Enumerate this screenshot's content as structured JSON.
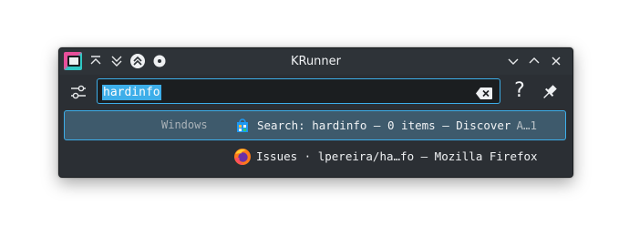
{
  "window": {
    "title": "KRunner",
    "app_icon": "krunner-app-icon",
    "titlebar_buttons_left": [
      "keep-above-icon",
      "keep-below-icon",
      "shade-icon",
      "on-all-desktops-icon"
    ],
    "titlebar_buttons_right": [
      "minimize-icon",
      "maximize-icon",
      "close-icon"
    ]
  },
  "search": {
    "query": "hardinfo",
    "config_icon": "configure-icon",
    "clear_icon": "clear-text-icon",
    "help_label": "?",
    "pin_icon": "pin-icon"
  },
  "results": [
    {
      "category": "Windows",
      "icon": "discover-icon",
      "text": "Search: hardinfo – 0 items — Discover",
      "subtext": "A…1",
      "selected": true
    },
    {
      "category": "",
      "icon": "firefox-icon",
      "text": "Issues · lpereira/ha…fo — Mozilla Firefox",
      "subtext": "",
      "selected": false
    }
  ],
  "colors": {
    "accent": "#3daee9",
    "window_bg": "#2b2f34",
    "selected_bg": "#3e5a6c"
  }
}
